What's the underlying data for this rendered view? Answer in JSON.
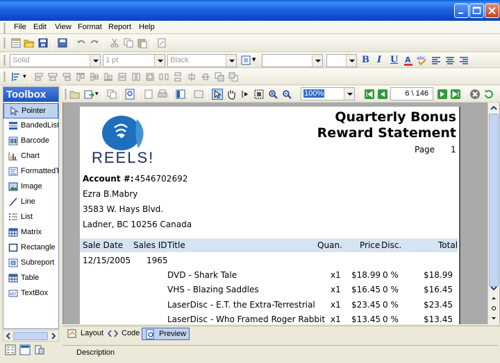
{
  "menu": {
    "file": "File",
    "edit": "Edit",
    "view": "View",
    "format": "Format",
    "report": "Report",
    "help": "Help"
  },
  "format_toolbar": {
    "line_style": "Solid",
    "line_width": "1 pt",
    "color": "Black",
    "bold": "B",
    "italic": "I",
    "underline": "U"
  },
  "preview_toolbar": {
    "zoom": "100%",
    "page_indicator": "6 \\ 146"
  },
  "toolbox": {
    "title": "Toolbox",
    "items": [
      {
        "label": "Pointer",
        "icon": "pointer-icon"
      },
      {
        "label": "BandedList",
        "icon": "bandedlist-icon"
      },
      {
        "label": "Barcode",
        "icon": "barcode-icon"
      },
      {
        "label": "Chart",
        "icon": "chart-icon"
      },
      {
        "label": "FormattedTex",
        "icon": "formattedtext-icon"
      },
      {
        "label": "Image",
        "icon": "image-icon"
      },
      {
        "label": "Line",
        "icon": "line-icon"
      },
      {
        "label": "List",
        "icon": "list-icon"
      },
      {
        "label": "Matrix",
        "icon": "matrix-icon"
      },
      {
        "label": "Rectangle",
        "icon": "rectangle-icon"
      },
      {
        "label": "Subreport",
        "icon": "subreport-icon"
      },
      {
        "label": "Table",
        "icon": "table-icon"
      },
      {
        "label": "TextBox",
        "icon": "textbox-icon"
      }
    ]
  },
  "report": {
    "logo_text": "REELS!",
    "title_line1": "Quarterly Bonus",
    "title_line2": "Reward Statement",
    "page_label": "Page",
    "page_number": "1",
    "account_label": "Account #:",
    "account_number": "4546702692",
    "customer_name": "Ezra B.Mabry",
    "address_line1": "3583 W. Hays Blvd.",
    "address_line2": "Ladner, BC  10256  Canada",
    "columns": {
      "sale_date": "Sale Date",
      "sales_id": "Sales ID",
      "title": "Title",
      "quan": "Quan.",
      "price": "Price",
      "disc": "Disc.",
      "total": "Total"
    },
    "sale": {
      "date": "12/15/2005",
      "id": "1965"
    },
    "rows": [
      {
        "title": "DVD - Shark Tale",
        "quan": "x1",
        "price": "$18.99",
        "disc": "0 %",
        "total": "$18.99"
      },
      {
        "title": "VHS - Blazing Saddles",
        "quan": "x1",
        "price": "$16.45",
        "disc": "0 %",
        "total": "$16.45"
      },
      {
        "title": "LaserDisc - E.T. the Extra-Terrestrial",
        "quan": "x1",
        "price": "$23.45",
        "disc": "0 %",
        "total": "$23.45"
      },
      {
        "title": "LaserDisc - Who Framed Roger Rabbit",
        "quan": "x1",
        "price": "$13.45",
        "disc": "0 %",
        "total": "$13.45"
      }
    ]
  },
  "tabs": {
    "layout": "Layout",
    "code": "Code",
    "preview": "Preview"
  },
  "description_label": "Description"
}
